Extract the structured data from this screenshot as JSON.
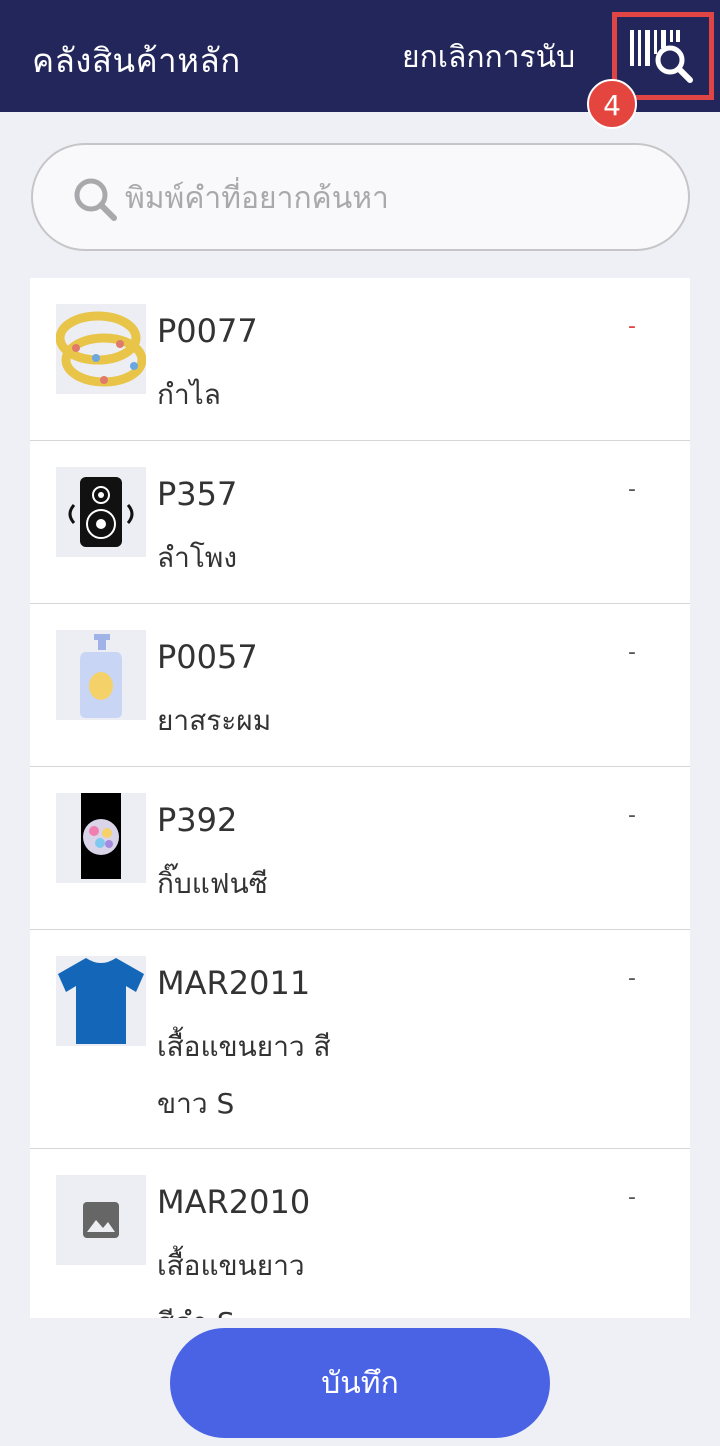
{
  "header": {
    "title": "คลังสินค้าหลัก",
    "cancel_label": "ยกเลิกการนับ",
    "scan_icon": "barcode-search-icon",
    "badge_number": "4",
    "highlight_color": "#e04545"
  },
  "search": {
    "placeholder": "พิมพ์คำที่อยากค้นหา",
    "value": ""
  },
  "products": [
    {
      "code": "P0077",
      "name": "กำไล",
      "qty": "-",
      "image": "bangle-image"
    },
    {
      "code": "P357",
      "name": "ลำโพง",
      "qty": "-",
      "image": "speaker-image"
    },
    {
      "code": "P0057",
      "name": "ยาสระผม",
      "qty": "-",
      "image": "shampoo-image"
    },
    {
      "code": "P392",
      "name": "กิ๊บแฟนซี",
      "qty": "-",
      "image": "hairclip-image"
    },
    {
      "code": "MAR2011",
      "name": "เสื้อแขนยาว สี ขาว S",
      "qty": "-",
      "image": "tshirt-image"
    },
    {
      "code": "MAR2010",
      "name": "เสื้อแขนยาว สีดำ S",
      "qty": "-",
      "image": "placeholder-image"
    }
  ],
  "footer": {
    "save_label": "บันทึก"
  },
  "colors": {
    "header_bg": "#23265a",
    "accent": "#4a63e5",
    "badge": "#e4463f"
  }
}
